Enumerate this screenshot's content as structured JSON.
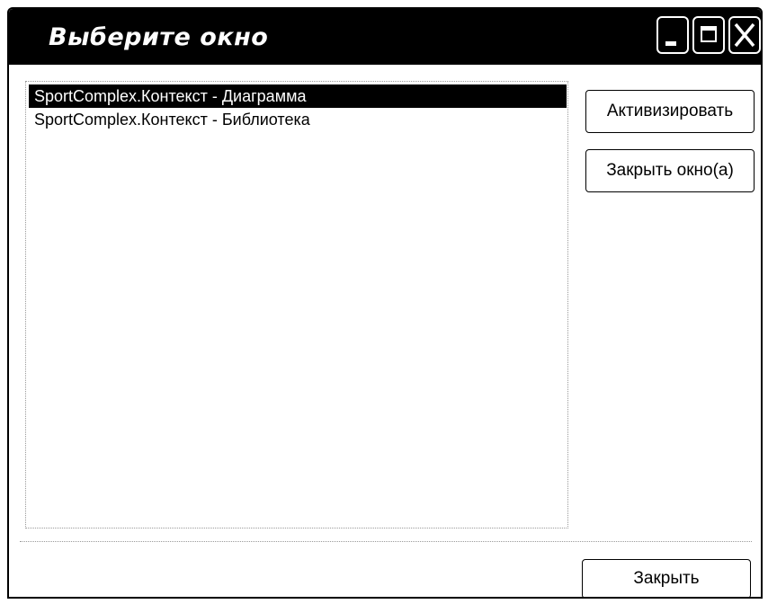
{
  "window": {
    "title": "Выберите окно"
  },
  "titlebar_buttons": {
    "minimize": "minimize-icon",
    "maximize": "maximize-icon",
    "close": "close-icon"
  },
  "windows_list": {
    "items": [
      {
        "label": "SportComplex.Контекст - Диаграмма",
        "selected": true
      },
      {
        "label": "SportComplex.Контекст - Библиотека",
        "selected": false
      }
    ]
  },
  "actions": {
    "activate_label": "Активизировать",
    "close_windows_label": "Закрыть окно(а)",
    "close_label": "Закрыть"
  }
}
